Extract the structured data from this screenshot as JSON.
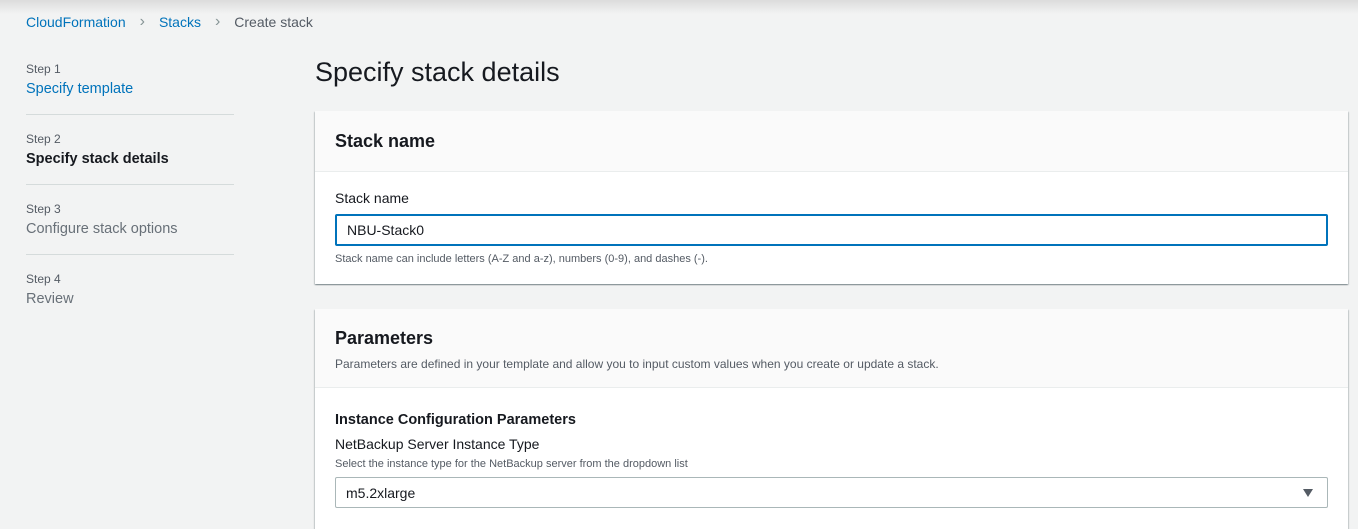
{
  "breadcrumb": {
    "items": [
      "CloudFormation",
      "Stacks"
    ],
    "current": "Create stack"
  },
  "steps": [
    {
      "number": "Step 1",
      "title": "Specify template",
      "state": "completed"
    },
    {
      "number": "Step 2",
      "title": "Specify stack details",
      "state": "active"
    },
    {
      "number": "Step 3",
      "title": "Configure stack options",
      "state": "upcoming"
    },
    {
      "number": "Step 4",
      "title": "Review",
      "state": "upcoming"
    }
  ],
  "page_title": "Specify stack details",
  "stack_name_section": {
    "title": "Stack name",
    "field_label": "Stack name",
    "value": "NBU-Stack0",
    "constraint": "Stack name can include letters (A-Z and a-z), numbers (0-9), and dashes (-)."
  },
  "parameters_section": {
    "title": "Parameters",
    "description": "Parameters are defined in your template and allow you to input custom values when you create or update a stack.",
    "group_title": "Instance Configuration Parameters",
    "instance_type": {
      "label": "NetBackup Server Instance Type",
      "description": "Select the instance type for the NetBackup server from the dropdown list",
      "selected": "m5.2xlarge"
    }
  },
  "icons": {
    "breadcrumb_separator": "chevron-right-icon",
    "dropdown": "caret-down-icon"
  },
  "colors": {
    "link": "#0073bb",
    "background": "#f2f3f3",
    "focus_border": "#0073bb"
  }
}
